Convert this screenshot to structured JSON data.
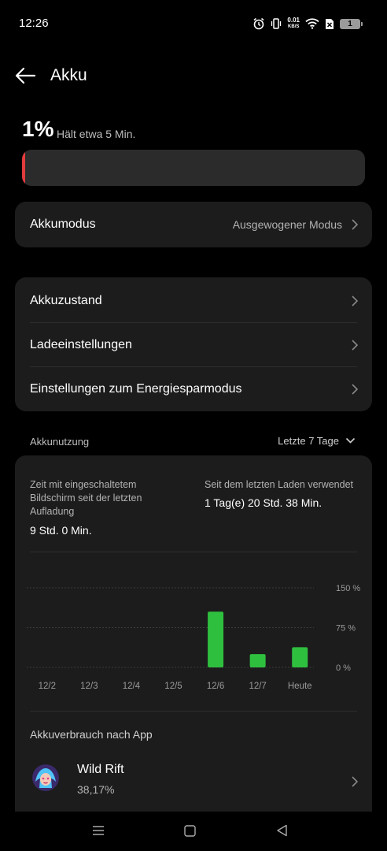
{
  "status_bar": {
    "time": "12:26",
    "net_speed": "0.01",
    "net_unit": "KB/S",
    "battery_level": "1"
  },
  "header": {
    "title": "Akku"
  },
  "battery": {
    "percent_text": "1%",
    "estimate": "Hält etwa 5 Min.",
    "level_fraction": 0.01,
    "fill_color": "#e23b3b"
  },
  "mode_card": {
    "label": "Akkumodus",
    "value": "Ausgewogener Modus"
  },
  "settings_card": {
    "items": [
      {
        "label": "Akkuzustand"
      },
      {
        "label": "Ladeeinstellungen"
      },
      {
        "label": "Einstellungen zum Energiesparmodus"
      }
    ]
  },
  "usage": {
    "section_label": "Akkunutzung",
    "range_label": "Letzte 7 Tage",
    "screen_on_label": "Zeit mit eingeschaltetem Bildschirm seit der letzten Aufladung",
    "screen_on_value": "9 Std. 0 Min.",
    "since_charge_label": "Seit dem letzten Laden verwendet",
    "since_charge_value": "1 Tag(e) 20 Std. 38 Min."
  },
  "chart_data": {
    "type": "bar",
    "categories": [
      "12/2",
      "12/3",
      "12/4",
      "12/5",
      "12/6",
      "12/7",
      "Heute"
    ],
    "values": [
      0,
      0,
      0,
      0,
      105,
      25,
      38
    ],
    "ylim": [
      0,
      150
    ],
    "yticks": [
      "150 %",
      "75 %",
      "0 %"
    ],
    "bar_color": "#2fbf3f",
    "grid": true
  },
  "per_app": {
    "section_label": "Akkuverbrauch nach App",
    "apps": [
      {
        "name": "Wild Rift",
        "percent": "38,17%"
      }
    ]
  },
  "nav": {
    "icons": [
      "menu-icon",
      "home-icon",
      "back-icon"
    ]
  }
}
